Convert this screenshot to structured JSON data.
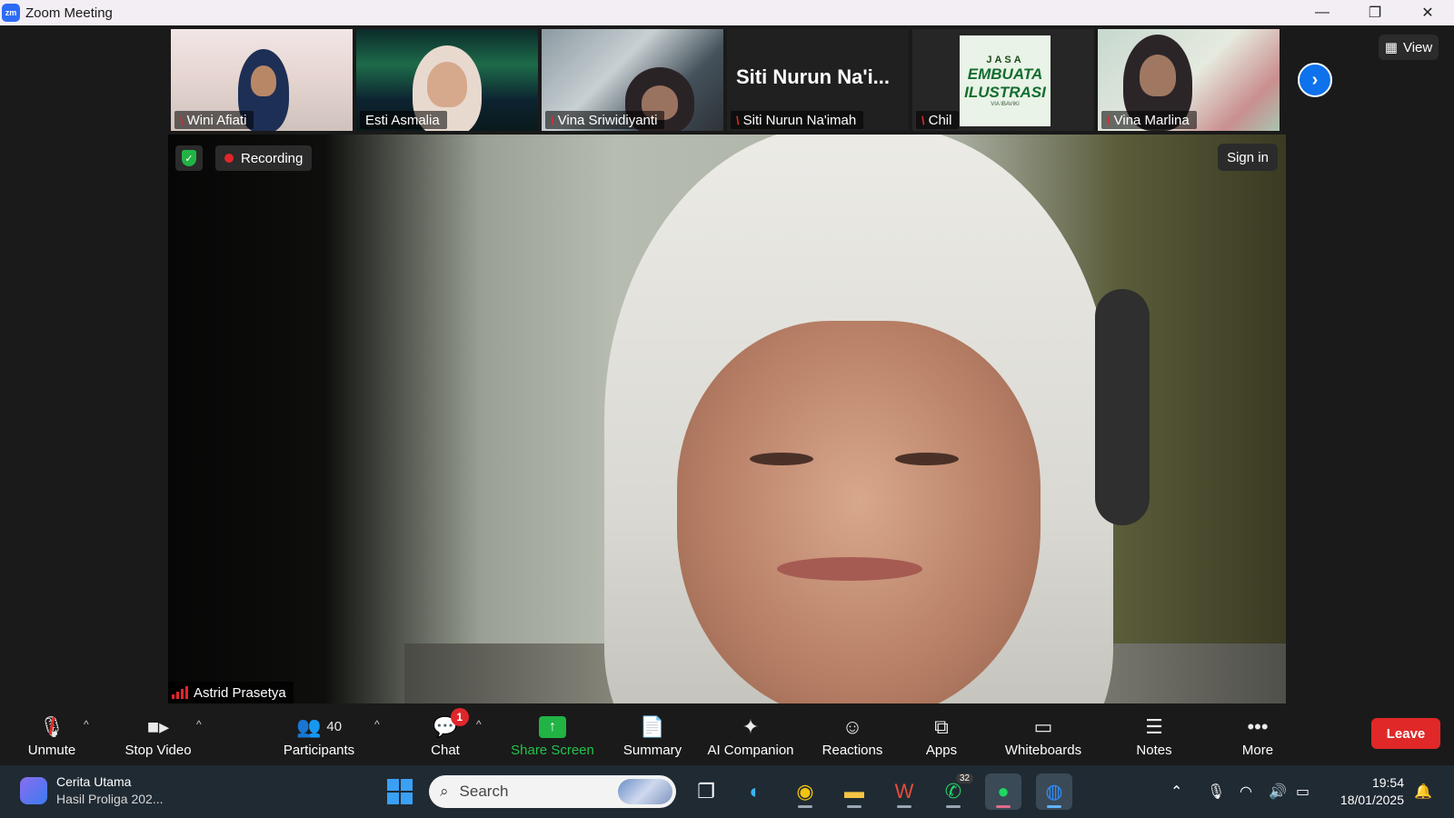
{
  "window": {
    "title": "Zoom Meeting",
    "app_badge": "zm"
  },
  "window_controls": {
    "minimize": "—",
    "restore": "❐",
    "close": "✕"
  },
  "thumbnails": [
    {
      "name": "Wini Afiati",
      "muted": true
    },
    {
      "name": "Esti Asmalia",
      "muted": false
    },
    {
      "name": "Vina Sriwidiyanti",
      "muted": true
    },
    {
      "name": "Siti Nurun Na'imah",
      "muted": true,
      "big_label": "Siti Nurun Na'i..."
    },
    {
      "name": "Chil",
      "muted": true,
      "poster_top": "JASA",
      "poster_lines": [
        "EMBUATA",
        "ILUSTRASI"
      ],
      "poster_small": "VIA IBAVIKI"
    },
    {
      "name": "Vina Marlina",
      "muted": true
    }
  ],
  "view_button": {
    "label": "View"
  },
  "main_video": {
    "recording_label": "Recording",
    "sign_in_label": "Sign in",
    "speaker_name": "Astrid Prasetya"
  },
  "toolbar": {
    "unmute": "Unmute",
    "stop_video": "Stop Video",
    "participants": "Participants",
    "participants_count": "40",
    "chat": "Chat",
    "chat_badge": "1",
    "share_screen": "Share Screen",
    "summary": "Summary",
    "ai_companion": "AI Companion",
    "reactions": "Reactions",
    "apps": "Apps",
    "whiteboards": "Whiteboards",
    "notes": "Notes",
    "more": "More",
    "leave": "Leave"
  },
  "taskbar": {
    "news_title": "Cerita Utama",
    "news_subtitle": "Hasil Proliga 202...",
    "search_placeholder": "Search",
    "whatsapp_badge": "32",
    "time": "19:54",
    "date": "18/01/2025"
  },
  "colors": {
    "accent": "#0e72ed",
    "recording": "#e0262b",
    "share": "#22b345",
    "leave": "#e02828"
  }
}
